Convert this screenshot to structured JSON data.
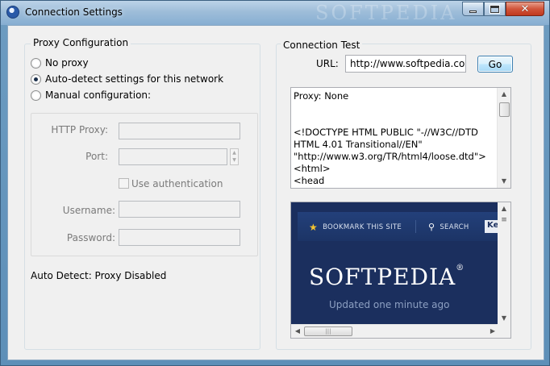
{
  "window": {
    "title": "Connection Settings",
    "watermark": "SOFTPEDIA",
    "controls": {
      "minimize_icon": "minimize-icon",
      "maximize_icon": "maximize-icon",
      "close_icon": "close-icon"
    }
  },
  "proxy": {
    "legend": "Proxy Configuration",
    "options": [
      {
        "label": "No proxy",
        "checked": false
      },
      {
        "label": "Auto-detect settings for this network",
        "checked": true
      },
      {
        "label": "Manual configuration:",
        "checked": false
      }
    ],
    "manual": {
      "http_proxy_label": "HTTP Proxy:",
      "http_proxy_value": "",
      "port_label": "Port:",
      "port_value": "",
      "use_auth_label": "Use authentication",
      "username_label": "Username:",
      "username_value": "",
      "password_label": "Password:",
      "password_value": ""
    },
    "status": "Auto Detect: Proxy Disabled"
  },
  "test": {
    "legend": "Connection Test",
    "url_label": "URL:",
    "url_value": "http://www.softpedia.com",
    "go_label": "Go",
    "response_text": "Proxy: None\n\n\n<!DOCTYPE HTML PUBLIC \"-//W3C//DTD HTML 4.01 Transitional//EN\" \"http://www.w3.org/TR/html4/loose.dtd\">\n<html>\n<head",
    "preview": {
      "bookmark_label": "BOOKMARK THIS SITE",
      "search_label": "SEARCH",
      "key_label": "Key",
      "logo_text": "SOFTPEDIA",
      "logo_mark": "®",
      "updated_text": "Updated one minute ago"
    }
  },
  "colors": {
    "accent": "#1b2f5e",
    "title_bar": "#9ebdd9",
    "close": "#c0391f"
  }
}
